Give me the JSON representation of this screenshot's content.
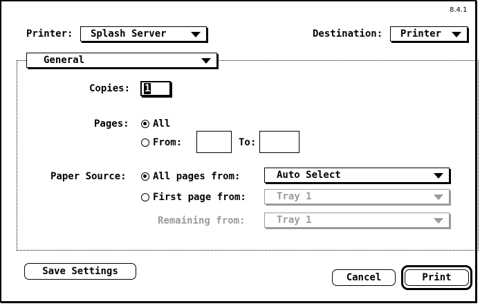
{
  "version": "8.4.1",
  "printer": {
    "label": "Printer:",
    "value": "Splash Server"
  },
  "destination": {
    "label": "Destination:",
    "value": "Printer"
  },
  "panel_popup": {
    "value": "General"
  },
  "copies": {
    "label": "Copies:",
    "value": "1"
  },
  "pages": {
    "label": "Pages:",
    "all_label": "All",
    "from_label": "From:",
    "to_label": "To:",
    "from_value": "",
    "to_value": "",
    "selected": "All"
  },
  "paper_source": {
    "label": "Paper Source:",
    "all_pages_label": "All pages from:",
    "all_pages_value": "Auto Select",
    "first_page_label": "First page from:",
    "first_page_value": "Tray 1",
    "remaining_label": "Remaining from:",
    "remaining_value": "Tray 1",
    "selected": "All pages from:"
  },
  "buttons": {
    "save": "Save Settings",
    "cancel": "Cancel",
    "print": "Print"
  }
}
